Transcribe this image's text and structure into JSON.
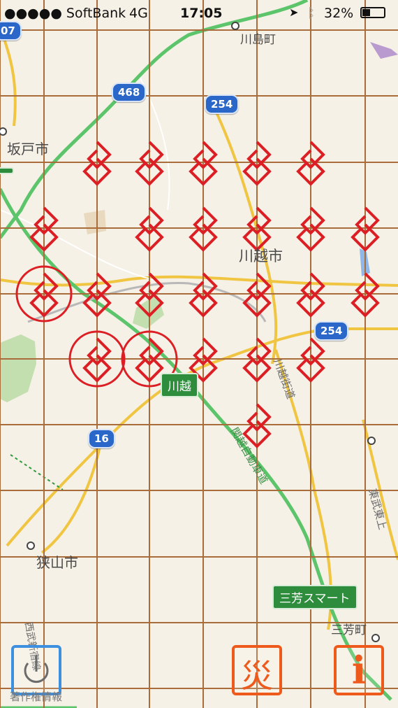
{
  "status_bar": {
    "carrier": "●●●●● SoftBank",
    "network": "4G",
    "time": "17:05",
    "battery": "32%"
  },
  "map": {
    "places": [
      {
        "id": "kawajima",
        "label": "川島町"
      },
      {
        "id": "sakado",
        "label": "坂戸市"
      },
      {
        "id": "kawagoe-city",
        "label": "川越市"
      },
      {
        "id": "sayama",
        "label": "狭山市"
      },
      {
        "id": "miyoshi",
        "label": "三芳町"
      }
    ],
    "route_shields": [
      "07",
      "468",
      "254",
      "254",
      "16"
    ],
    "road_labels": [
      "川越街道",
      "関越自動車道",
      "東武東上",
      "西武新宿線"
    ],
    "green_signs": [
      "川越",
      "三芳スマート"
    ],
    "colors": {
      "grid": "#a86d3b",
      "marker": "#dc1f25",
      "expressway": "#5cc46a",
      "road": "#f0c542"
    }
  },
  "controls": {
    "power": {
      "icon": "power-icon",
      "color": "#3d8fe0"
    },
    "kanji": {
      "label": "災",
      "color": "#ee5a1c"
    },
    "info": {
      "label": "i",
      "color": "#ee5a1c"
    },
    "overlay_text": "著作権情報"
  }
}
